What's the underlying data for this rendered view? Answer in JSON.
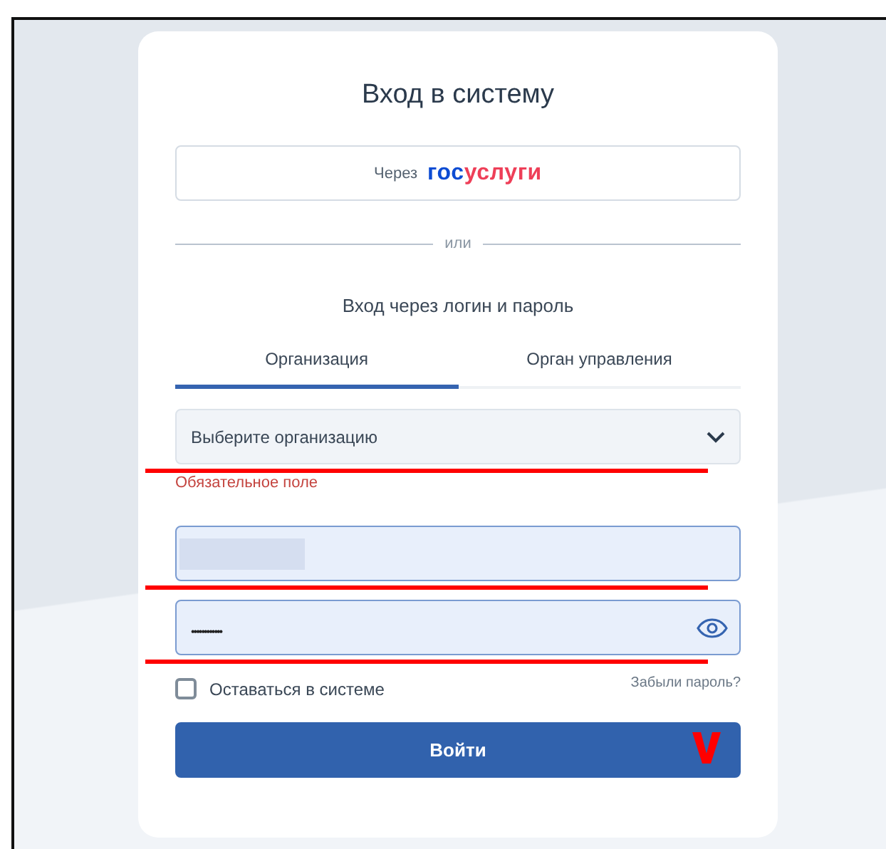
{
  "title": "Вход в систему",
  "gosuslugi_button": {
    "prefix": "Через",
    "logo_parts": [
      {
        "text": "гос",
        "color": "#0d4cd3"
      },
      {
        "text": "услуги",
        "color": "#ee3f58"
      }
    ]
  },
  "divider_text": "или",
  "subtitle": "Вход через логин и пароль",
  "tabs": [
    {
      "label": "Организация",
      "selected": true
    },
    {
      "label": "Орган управления",
      "selected": false
    }
  ],
  "organization_select": {
    "placeholder": "Выберите организацию",
    "error": "Обязательное поле",
    "underlined": true
  },
  "login_field": {
    "redacted": true,
    "underlined": true
  },
  "password_field": {
    "value": "••••••••••••",
    "underlined": true
  },
  "remember_checkbox": {
    "label": "Оставаться в системе",
    "checked": false
  },
  "forgot_link": "Забыли пароль?",
  "submit_button": {
    "label": "Войти",
    "checkmark": true
  }
}
